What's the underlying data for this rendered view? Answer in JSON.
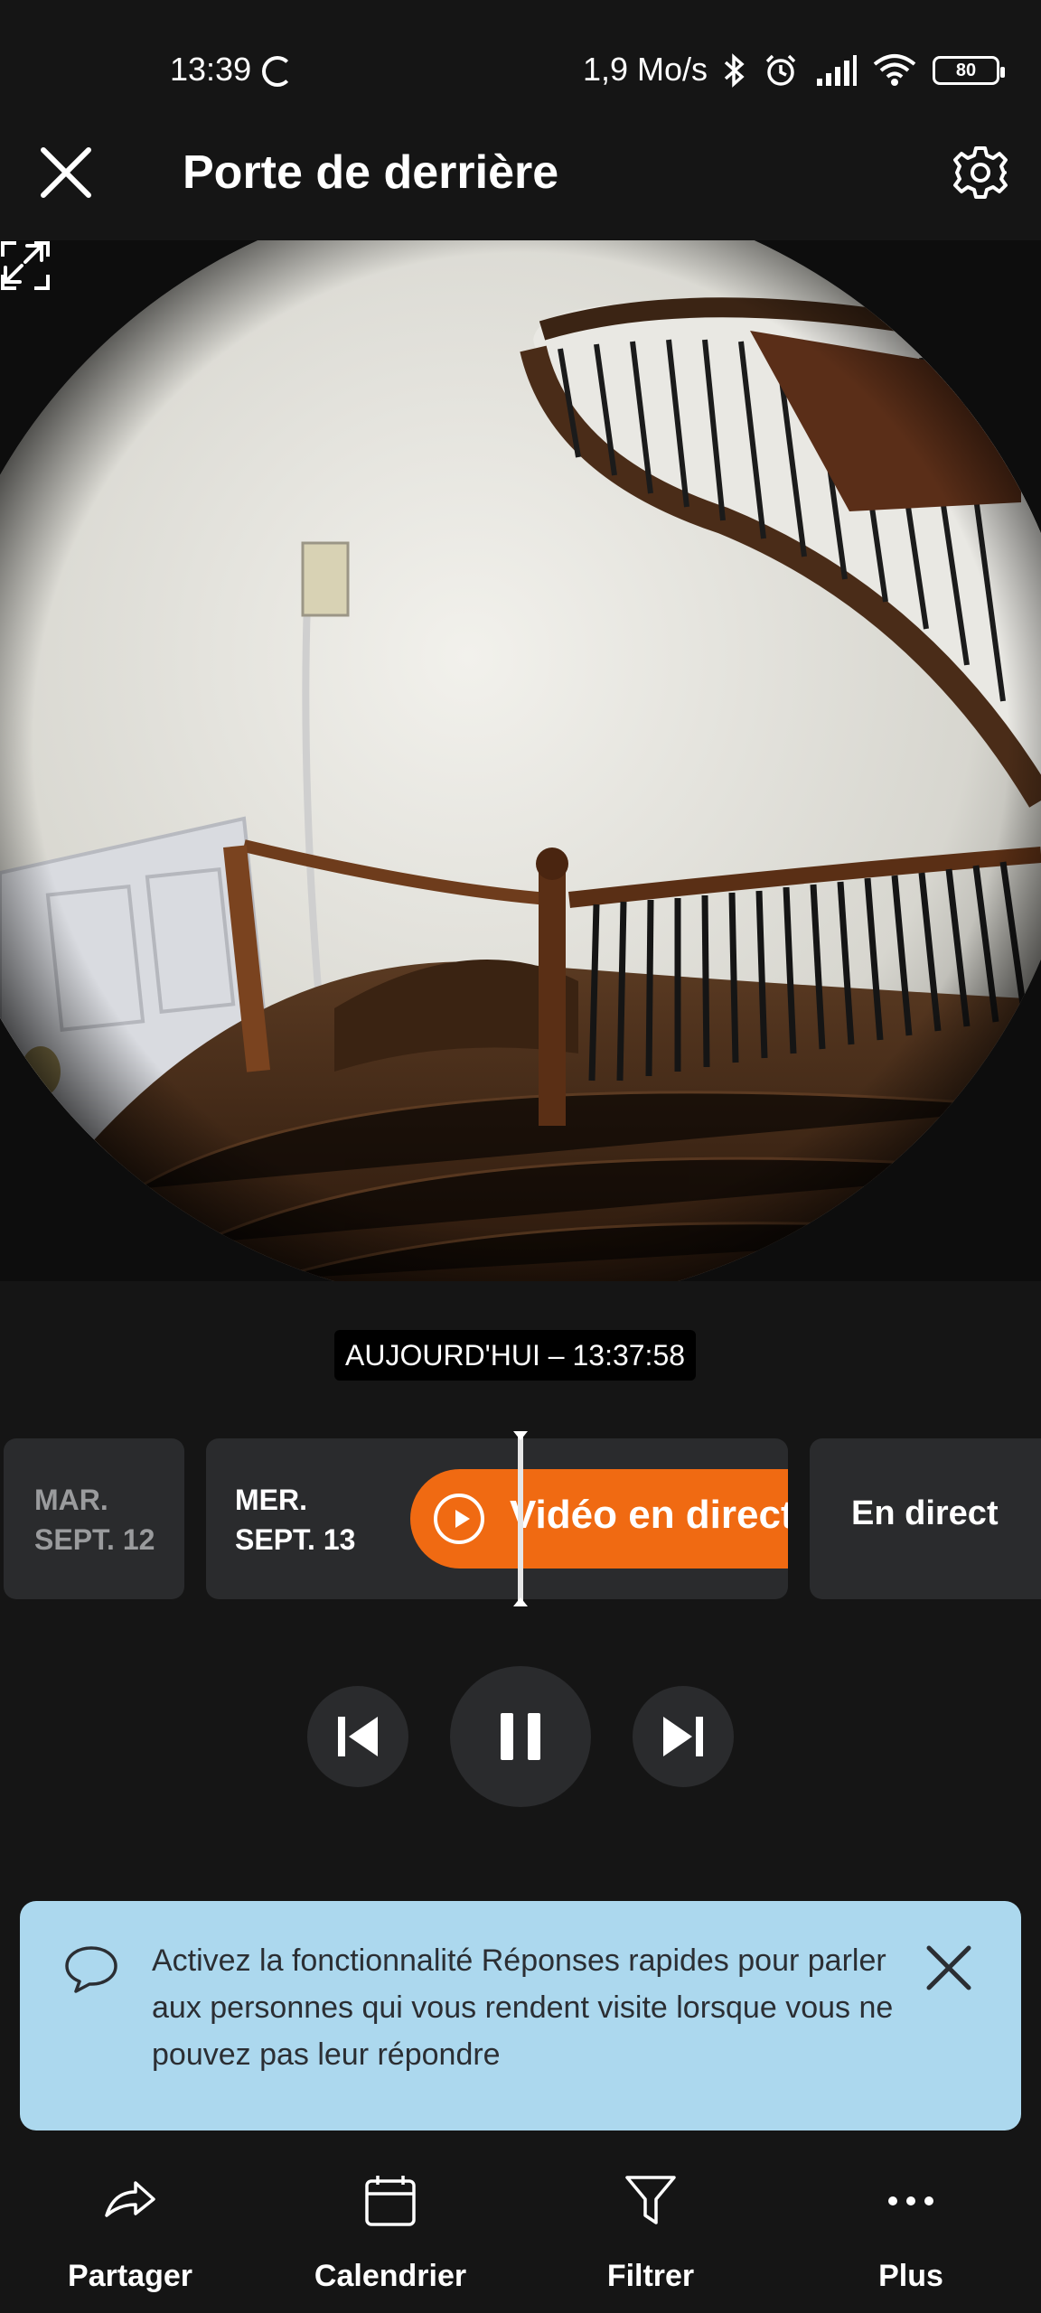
{
  "status_bar": {
    "time": "13:39",
    "network_speed": "1,9 Mo/s",
    "battery_level": "80",
    "icons": [
      "sync-icon",
      "bluetooth-icon",
      "alarm-icon",
      "signal-icon",
      "wifi-icon",
      "battery-icon"
    ]
  },
  "header": {
    "title": "Porte de derrière",
    "close_icon": "close-icon",
    "settings_icon": "gear-icon"
  },
  "player": {
    "timestamp": "AUJOURD'HUI – 13:37:58",
    "icons": [
      "expand-icon",
      "fullscreen-icon"
    ]
  },
  "timeline": {
    "days": [
      {
        "day": "MAR.",
        "date": "SEPT. 12"
      },
      {
        "day": "MER.",
        "date": "SEPT. 13"
      }
    ],
    "live_video_label": "Vidéo en direct",
    "live_label": "En direct"
  },
  "controls": {
    "icons": [
      "skip-previous-icon",
      "pause-icon",
      "skip-next-icon"
    ]
  },
  "banner": {
    "text": "Activez la fonctionnalité Réponses rapides pour parler aux personnes qui vous rendent visite lorsque vous ne pouvez pas leur répondre"
  },
  "bottom_nav": {
    "items": [
      {
        "label": "Partager",
        "icon": "share-icon"
      },
      {
        "label": "Calendrier",
        "icon": "calendar-icon"
      },
      {
        "label": "Filtrer",
        "icon": "filter-icon"
      },
      {
        "label": "Plus",
        "icon": "more-icon"
      }
    ]
  },
  "colors": {
    "background": "#151515",
    "card": "#2a2b2d",
    "accent": "#f06a12",
    "banner": "#acd8ee"
  }
}
